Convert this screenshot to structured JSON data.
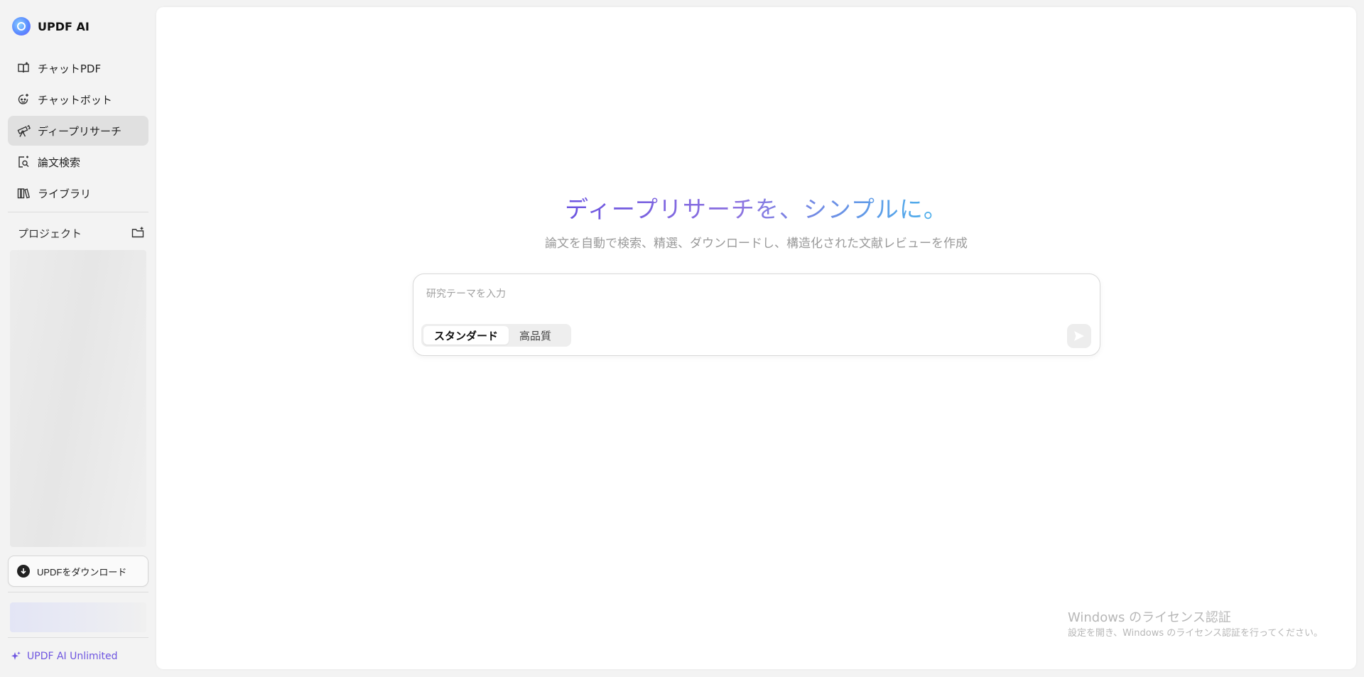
{
  "app": {
    "name": "UPDF AI"
  },
  "sidebar": {
    "items": [
      {
        "label": "チャットPDF",
        "icon": "book-open-icon"
      },
      {
        "label": "チャットボット",
        "icon": "chatbot-face-icon"
      },
      {
        "label": "ディープリサーチ",
        "icon": "telescope-icon",
        "active": true
      },
      {
        "label": "論文検索",
        "icon": "doc-search-icon"
      },
      {
        "label": "ライブラリ",
        "icon": "library-books-icon"
      }
    ],
    "project_label": "プロジェクト",
    "download_label": "UPDFをダウンロード",
    "unlimited_label": "UPDF AI Unlimited"
  },
  "main": {
    "title": "ディープリサーチを、シンプルに。",
    "subtitle": "論文を自動で検索、精選、ダウンロードし、構造化された文献レビューを作成",
    "composer": {
      "placeholder": "研究テーマを入力",
      "value": "",
      "modes": [
        "スタンダード",
        "高品質"
      ],
      "selected_mode": "スタンダード"
    }
  },
  "watermark": {
    "title": "Windows のライセンス認証",
    "subtitle": "設定を開き、Windows のライセンス認証を行ってください。"
  },
  "colors": {
    "accent": "#6e55e0",
    "title_gradient_start": "#6b54e0",
    "title_gradient_end": "#46b3ec",
    "active_nav_bg": "#e0e0e0"
  }
}
